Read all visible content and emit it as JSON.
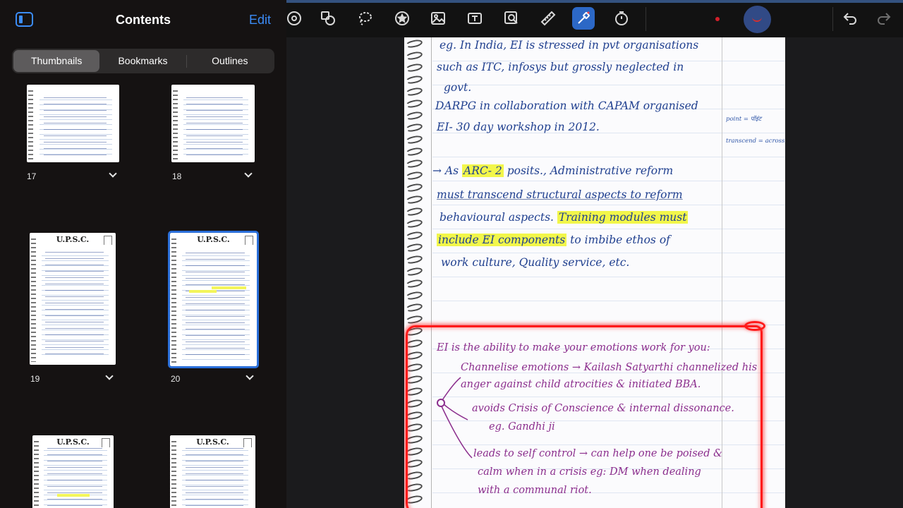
{
  "sidebar": {
    "title": "Contents",
    "edit_label": "Edit",
    "tabs": [
      {
        "label": "Thumbnails",
        "active": true
      },
      {
        "label": "Bookmarks",
        "active": false
      },
      {
        "label": "Outlines",
        "active": false
      }
    ],
    "thumbnails": [
      {
        "page": "17",
        "header": "",
        "selected": false
      },
      {
        "page": "18",
        "header": "",
        "selected": false
      },
      {
        "page": "19",
        "header": "U.P.S.C.",
        "selected": false
      },
      {
        "page": "20",
        "header": "U.P.S.C.",
        "selected": true
      },
      {
        "page": "",
        "header": "U.P.S.C.",
        "selected": false
      },
      {
        "page": "",
        "header": "U.P.S.C.",
        "selected": false
      }
    ]
  },
  "toolbar": {
    "tools": [
      "disc-icon",
      "shapes-icon",
      "lasso-icon",
      "sticker-icon",
      "image-icon",
      "text-box-icon",
      "image-search-icon",
      "ruler-icon",
      "laser-pointer-icon",
      "timer-icon",
      "undo-icon",
      "redo-icon"
    ],
    "active_tool": "laser-pointer-icon",
    "active_color": "#d21f2a"
  },
  "page": {
    "blue_lines": [
      "eg. In India, EI is stressed in pvt organisations",
      "such as ITC, infosys but grossly neglected in",
      "govt.",
      "DARPG in collaboration with CAPAM organised",
      "EI- 30 day workshop in 2012."
    ],
    "arc_line": {
      "prefix": "→ As",
      "highlight": "ARC- 2",
      "rest": "posits., Administrative reform"
    },
    "arc_lines": [
      "must transcend structural aspects to reform",
      "behavioural aspects."
    ],
    "training_highlight_1": "Training modules must",
    "training_highlight_2": "include EI components",
    "training_rest": "to imbibe ethos of",
    "last_blue_line": "work culture, Quality service, etc.",
    "margin_notes": [
      "point = पॉइंट",
      "transcend = across, etc."
    ],
    "purple_lines": [
      "EI is the ability to make your emotions work for you:",
      "Channelise emotions → Kailash Satyarthi channelized his",
      "anger against child atrocities & initiated BBA.",
      "avoids Crisis of Conscience & internal dissonance.",
      "eg. Gandhi ji",
      "leads to self control → can help one be poised &",
      "calm when in a crisis eg: DM when dealing",
      "with a communal riot."
    ]
  }
}
